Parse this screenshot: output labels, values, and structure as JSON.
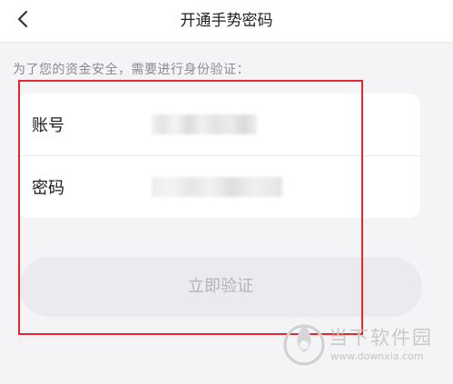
{
  "header": {
    "title": "开通手势密码",
    "back_icon": "chevron-left-icon"
  },
  "notice": "为了您的资金安全，需要进行身份验证：",
  "form": {
    "account_label": "账号",
    "password_label": "密码"
  },
  "verify_button": "立即验证",
  "watermark": {
    "text": "当下软件园",
    "url": "www.downxia.com"
  },
  "colors": {
    "background": "#f4f4f6",
    "highlight_border": "#e6272d",
    "button_bg": "#ebebef",
    "button_text": "#b3b3b8"
  }
}
